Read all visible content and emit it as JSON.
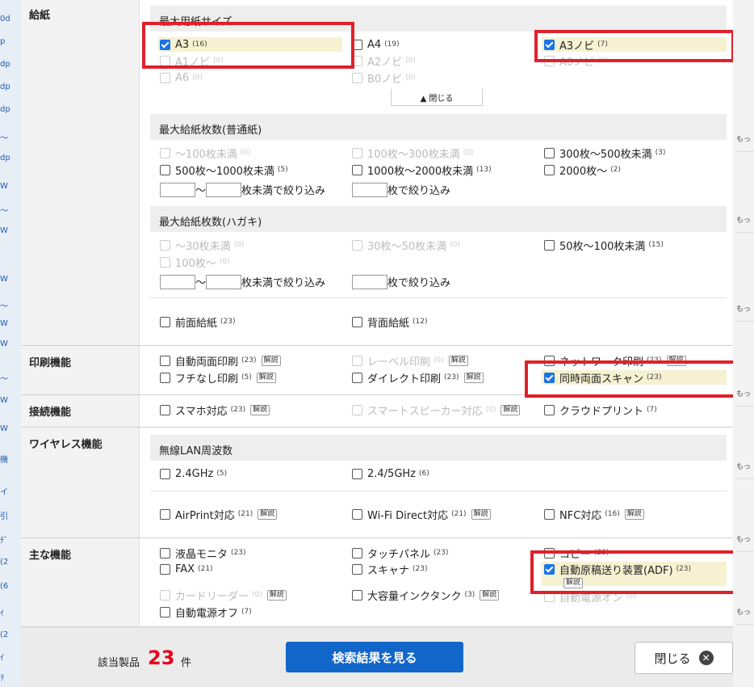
{
  "categories": {
    "paper": "給紙",
    "print": "印刷機能",
    "connect": "接続機能",
    "wireless": "ワイヤレス機能",
    "main": "主な機能"
  },
  "paper_size": {
    "heading": "最大用紙サイズ",
    "options": [
      {
        "label": "A3",
        "count": "(16)"
      },
      {
        "label": "A4",
        "count": "(19)"
      },
      {
        "label": "A3ノビ",
        "count": "(7)"
      },
      {
        "label": "A1ノビ",
        "count": "(0)"
      },
      {
        "label": "A2ノビ",
        "count": "(0)"
      },
      {
        "label": "A0ノビ",
        "count": "(0)"
      },
      {
        "label": "A6",
        "count": "(0)"
      },
      {
        "label": "B0ノビ",
        "count": "(0)"
      }
    ],
    "close_label": "▲ 閉じる"
  },
  "capacity_plain": {
    "heading": "最大給紙枚数(普通紙)",
    "options": [
      {
        "label": "～100枚未満",
        "count": "(0)"
      },
      {
        "label": "100枚～300枚未満",
        "count": "(0)"
      },
      {
        "label": "300枚～500枚未満",
        "count": "(3)"
      },
      {
        "label": "500枚～1000枚未満",
        "count": "(5)"
      },
      {
        "label": "1000枚～2000枚未満",
        "count": "(13)"
      },
      {
        "label": "2000枚～",
        "count": "(2)"
      }
    ]
  },
  "capacity_postcard": {
    "heading": "最大給紙枚数(ハガキ)",
    "options": [
      {
        "label": "～30枚未満",
        "count": "(0)"
      },
      {
        "label": "30枚～50枚未満",
        "count": "(0)"
      },
      {
        "label": "50枚～100枚未満",
        "count": "(15)"
      },
      {
        "label": "100枚～",
        "count": "(0)"
      }
    ]
  },
  "range": {
    "tilde": "～",
    "under_label": "枚未満で絞り込み",
    "filter_label": "枚で絞り込み"
  },
  "feed_position": [
    {
      "label": "前面給紙",
      "count": "(23)"
    },
    {
      "label": "背面給紙",
      "count": "(12)"
    }
  ],
  "explain_label": "解説",
  "print_features": [
    {
      "label": "自動両面印刷",
      "count": "(23)"
    },
    {
      "label": "レーベル印刷",
      "count": "(0)"
    },
    {
      "label": "ネットワーク印刷",
      "count": "(23)"
    },
    {
      "label": "フチなし印刷",
      "count": "(5)"
    },
    {
      "label": "ダイレクト印刷",
      "count": "(23)"
    },
    {
      "label": "同時両面スキャン",
      "count": "(23)"
    }
  ],
  "connection": [
    {
      "label": "スマホ対応",
      "count": "(23)"
    },
    {
      "label": "スマートスピーカー対応",
      "count": "(0)"
    },
    {
      "label": "クラウドプリント",
      "count": "(7)"
    }
  ],
  "wireless": {
    "heading": "無線LAN周波数",
    "freq": [
      {
        "label": "2.4GHz",
        "count": "(5)"
      },
      {
        "label": "2.4/5GHz",
        "count": "(6)"
      }
    ],
    "features": [
      {
        "label": "AirPrint対応",
        "count": "(21)"
      },
      {
        "label": "Wi-Fi Direct対応",
        "count": "(21)"
      },
      {
        "label": "NFC対応",
        "count": "(16)"
      }
    ]
  },
  "main_features": [
    {
      "label": "液晶モニタ",
      "count": "(23)"
    },
    {
      "label": "タッチパネル",
      "count": "(23)"
    },
    {
      "label": "コピー",
      "count": "(23)"
    },
    {
      "label": "FAX",
      "count": "(21)"
    },
    {
      "label": "スキャナ",
      "count": "(23)"
    },
    {
      "label": "自動原稿送り装置(ADF)",
      "count": "(23)"
    },
    {
      "label": "カードリーダー",
      "count": "(0)"
    },
    {
      "label": "大容量インクタンク",
      "count": "(3)"
    },
    {
      "label": "自動電源オン",
      "count": "(0)"
    },
    {
      "label": "自動電源オフ",
      "count": "(7)"
    }
  ],
  "footer": {
    "count_label": "該当製品",
    "count_value": "23",
    "count_unit": "件",
    "search_button": "検索結果を見る",
    "close_button": "閉じる"
  },
  "side_left": [
    "0d",
    "p",
    "dp",
    "dp",
    "dp",
    "～",
    "dp",
    "W",
    "～",
    "W",
    "W",
    "～",
    "W",
    "W",
    "～",
    "W",
    "W",
    "機",
    "イ",
    "引",
    "ﾁﾞ",
    "(2",
    "(6",
    "ｲ",
    "(2",
    "ｲ",
    "ｦ"
  ],
  "side_right_label": "もっ",
  "colors": {
    "accent": "#1366c9",
    "count_red": "#e4001b",
    "highlight": "#f6f1d1",
    "callout": "#e0202a"
  }
}
